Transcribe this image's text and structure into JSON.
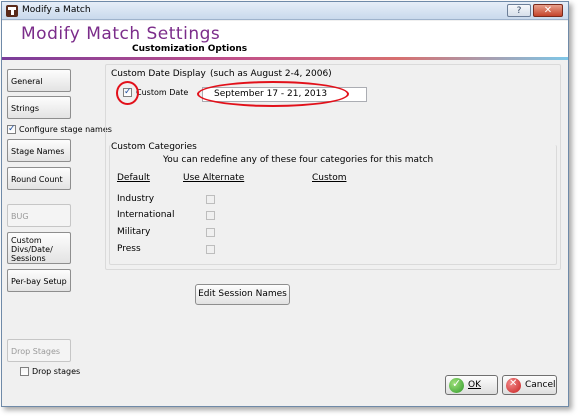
{
  "window": {
    "title": "Modify a Match",
    "help_label": "?",
    "close_label": "✕"
  },
  "header": {
    "title": "Modify Match Settings",
    "subtitle": "Customization Options"
  },
  "sidebar": {
    "general": "General",
    "strings": "Strings",
    "configure_stage_names": {
      "label": "Configure stage names",
      "checked": true
    },
    "stage_names": "Stage Names",
    "round_count": "Round Count",
    "bug": "BUG",
    "custom_divs": [
      "Custom",
      "Divs/Date/",
      "Sessions"
    ],
    "per_bay_setup": "Per-bay Setup",
    "drop_stages_button": "Drop Stages",
    "drop_stages_check": {
      "label": "Drop stages",
      "checked": false
    }
  },
  "custom_date": {
    "section_label": "Custom Date Display",
    "example": "(such as August 2-4, 2006)",
    "checkbox_label": "Custom Date",
    "checked": true,
    "value": "September 17 - 21, 2013"
  },
  "custom_categories": {
    "section_label": "Custom Categories",
    "description": "You can redefine any of these four categories for this match",
    "col_default": "Default",
    "col_use_alternate": "Use Alternate",
    "col_custom": "Custom",
    "rows": [
      {
        "label": "Industry",
        "checked": false
      },
      {
        "label": "International",
        "checked": false
      },
      {
        "label": "Military",
        "checked": false
      },
      {
        "label": "Press",
        "checked": false
      }
    ]
  },
  "edit_session_names": "Edit Session Names",
  "buttons": {
    "ok": "OK",
    "cancel": "Cancel"
  },
  "colors": {
    "header_title": "#7b2c8a",
    "annotation": "#e2101a"
  }
}
